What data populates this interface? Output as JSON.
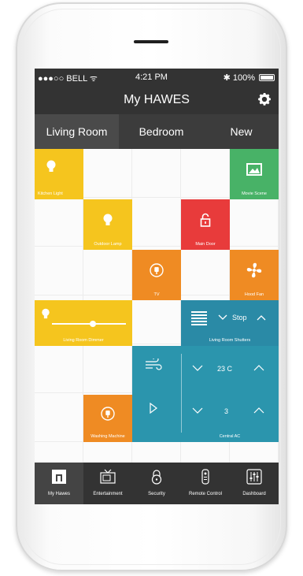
{
  "status": {
    "carrier": "●●●○○ BELL ᯤ",
    "time": "4:21 PM",
    "battery": "✱ 100%"
  },
  "header": {
    "title": "My HAWES"
  },
  "tabs": [
    {
      "label": "Living Room",
      "active": true
    },
    {
      "label": "Bedroom",
      "active": false
    },
    {
      "label": "New",
      "active": false
    }
  ],
  "tiles": {
    "kitchen_light": "Kitchen Light",
    "movie_scene": "Movie Scene",
    "outdoor_lamp": "Outdoor Lamp",
    "main_door": "Main Door",
    "tv": "TV",
    "hood_fan": "Hood Fan",
    "living_room_dimmer": "Living Room Dimmer",
    "living_room_shutters": "Living Room Shutters",
    "shutters_stop": "Stop",
    "washing_machine": "Washing Machine",
    "central_ac": "Central AC",
    "ac_temp": "23 C",
    "ac_fan": "3"
  },
  "dimmer_level": 0.55,
  "nav": [
    {
      "label": "My Hawes",
      "icon": "home-icon"
    },
    {
      "label": "Entertainment",
      "icon": "tv-icon"
    },
    {
      "label": "Security",
      "icon": "lock-icon"
    },
    {
      "label": "Remote Control",
      "icon": "remote-icon"
    },
    {
      "label": "Dashboard",
      "icon": "sliders-icon"
    }
  ],
  "colors": {
    "yellow": "#f5c51e",
    "green": "#48b267",
    "red": "#e83b3b",
    "orange": "#ef8b23",
    "teal": "#2a8aa6",
    "dark": "#333333"
  }
}
